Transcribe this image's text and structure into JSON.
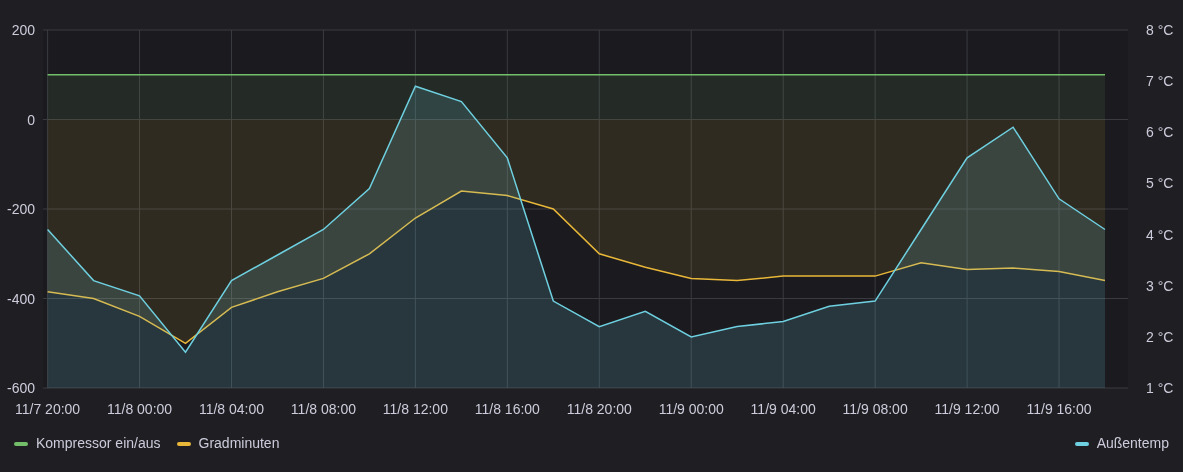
{
  "chart": {
    "chart_data": {
      "type": "area",
      "categories": [
        "11/7 20:00",
        null,
        "11/8 00:00",
        null,
        "11/8 04:00",
        null,
        "11/8 08:00",
        null,
        "11/8 12:00",
        null,
        "11/8 16:00",
        null,
        "11/8 20:00",
        null,
        "11/9 00:00",
        null,
        "11/9 04:00",
        null,
        "11/9 08:00",
        null,
        "11/9 12:00",
        null,
        "11/9 16:00",
        null
      ],
      "grid": true,
      "ylim": [
        -600,
        200
      ],
      "yticks": [
        -600,
        -400,
        -200,
        0,
        200
      ],
      "y2lim": [
        1,
        8
      ],
      "y2ticks": [
        {
          "value": 1,
          "label": "1 °C"
        },
        {
          "value": 2,
          "label": "2 °C"
        },
        {
          "value": 3,
          "label": "3 °C"
        },
        {
          "value": 4,
          "label": "4 °C"
        },
        {
          "value": 5,
          "label": "5 °C"
        },
        {
          "value": 6,
          "label": "6 °C"
        },
        {
          "value": 7,
          "label": "7 °C"
        },
        {
          "value": 8,
          "label": "8 °C"
        }
      ],
      "series": [
        {
          "name": "Kompressor ein/aus",
          "color": "#73bf69",
          "values": [
            100,
            100,
            100,
            100,
            100,
            100,
            100,
            100,
            100,
            100,
            100,
            100,
            100,
            100,
            100,
            100,
            100,
            100,
            100,
            100,
            100,
            100,
            100,
            100
          ]
        },
        {
          "name": "Gradminuten",
          "color": "#eab839",
          "values": [
            -385,
            -400,
            -440,
            -500,
            -420,
            -385,
            -355,
            -300,
            -220,
            -160,
            -170,
            -200,
            -300,
            -330,
            -355,
            -360,
            -350,
            -350,
            -350,
            -320,
            -335,
            -332,
            -340,
            -360
          ]
        },
        {
          "name": "Außentemp",
          "color": "#6ed0e0",
          "axis": "y2",
          "values": [
            4.1,
            3.1,
            2.8,
            1.7,
            3.1,
            3.6,
            4.1,
            4.9,
            6.9,
            6.6,
            5.5,
            2.7,
            2.2,
            2.5,
            2.0,
            2.2,
            2.3,
            2.6,
            2.7,
            4.1,
            5.5,
            6.1,
            4.7,
            4.1
          ]
        }
      ]
    }
  }
}
